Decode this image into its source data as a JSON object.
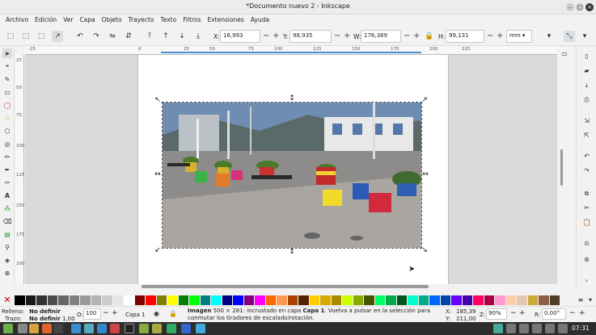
{
  "window": {
    "title": "*Documento nuevo 2 - Inkscape"
  },
  "menu": [
    "Archivo",
    "Edición",
    "Ver",
    "Capa",
    "Objeto",
    "Trayecto",
    "Texto",
    "Filtros",
    "Extensiones",
    "Ayuda"
  ],
  "toolbar": {
    "x_label": "X:",
    "x_value": "16,993",
    "y_label": "Y:",
    "y_value": "98,935",
    "w_label": "W:",
    "w_value": "176,389",
    "h_label": "H:",
    "h_value": "99,131",
    "unit": "mm"
  },
  "hruler_ticks": [
    "-25",
    "0",
    "25",
    "50",
    "75",
    "100",
    "125",
    "150",
    "175",
    "200",
    "225"
  ],
  "vruler_ticks": [
    "25",
    "50",
    "75",
    "100",
    "125",
    "150",
    "175",
    "200"
  ],
  "palette": [
    "#000000",
    "#1a1a1a",
    "#333333",
    "#4d4d4d",
    "#666666",
    "#808080",
    "#999999",
    "#b3b3b3",
    "#cccccc",
    "#e6e6e6",
    "#ffffff",
    "#800000",
    "#ff0000",
    "#808000",
    "#ffff00",
    "#008000",
    "#00ff00",
    "#008080",
    "#00ffff",
    "#000080",
    "#0000ff",
    "#800080",
    "#ff00ff",
    "#ff6600",
    "#ff9955",
    "#aa4400",
    "#552200",
    "#ffcc00",
    "#d4aa00",
    "#aa8800",
    "#ccff00",
    "#88aa00",
    "#445500",
    "#00ff66",
    "#00aa44",
    "#005522",
    "#00ffcc",
    "#00aa88",
    "#0066ff",
    "#0044aa",
    "#6600ff",
    "#4400aa",
    "#ff0066",
    "#aa0044",
    "#ff99cc",
    "#ffccaa",
    "#e9c6af",
    "#c8ab37",
    "#8d5f43",
    "#503c28"
  ],
  "status": {
    "fill_label": "Relleno:",
    "fill_value": "No definir",
    "stroke_label": "Trazo:",
    "stroke_value": "No definir",
    "stroke_width": "1,00",
    "opacity_label": "O:",
    "opacity_value": "100",
    "layer": "Capa 1",
    "message_bold": "Imagen",
    "message": " 500 × 281: incrustado en capa ",
    "message_layer": "Capa 1",
    "message_rest": ". Vuelva a pulsar en la selección para conmutar los tiradores de escalado/rotación.",
    "x_label": "X:",
    "x_value": "185,39",
    "y_label": "Y:",
    "y_value": "211,00",
    "zoom_label": "Z:",
    "zoom_value": "90%",
    "rot_label": "R:",
    "rot_value": "0,00°"
  },
  "taskbar": {
    "time": "07:31"
  }
}
